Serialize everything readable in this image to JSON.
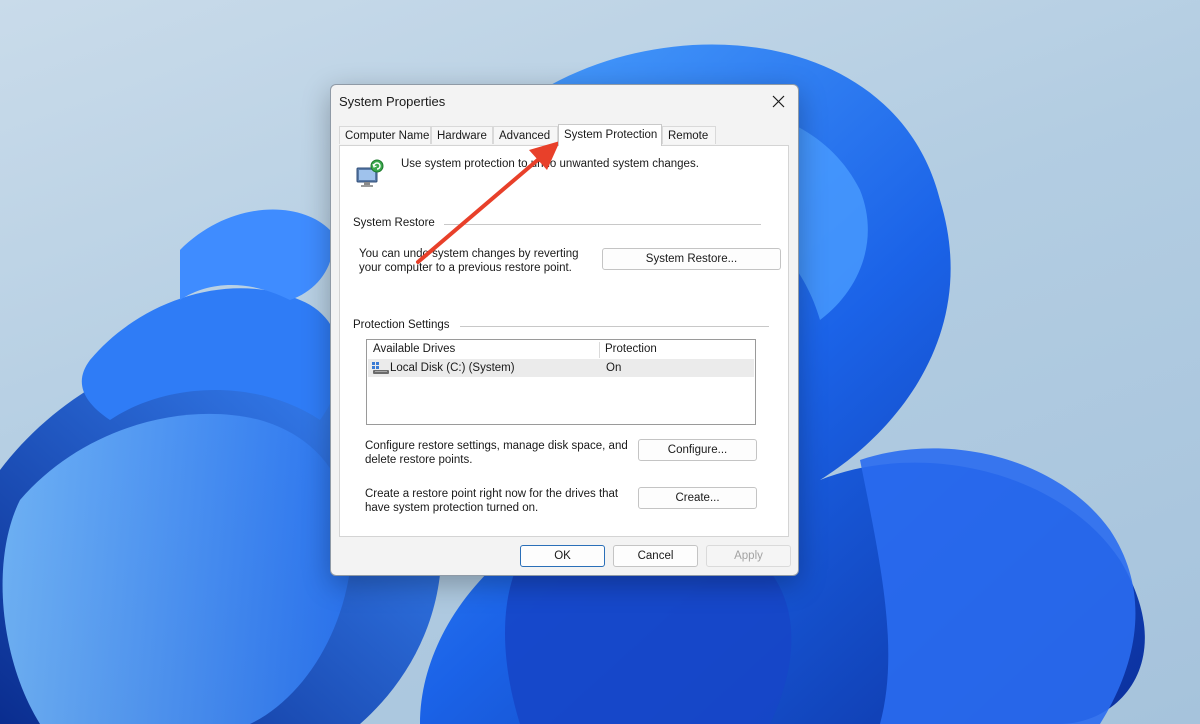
{
  "window": {
    "title": "System Properties"
  },
  "tabs": [
    {
      "label": "Computer Name"
    },
    {
      "label": "Hardware"
    },
    {
      "label": "Advanced"
    },
    {
      "label": "System Protection",
      "active": true
    },
    {
      "label": "Remote"
    }
  ],
  "intro_text": "Use system protection to undo unwanted system changes.",
  "system_restore": {
    "group_label": "System Restore",
    "description_line1": "You can undo system changes by reverting",
    "description_line2": "your computer to a previous restore point.",
    "button_label": "System Restore..."
  },
  "protection_settings": {
    "group_label": "Protection Settings",
    "columns": [
      "Available Drives",
      "Protection"
    ],
    "drives": [
      {
        "name": "Local Disk (C:) (System)",
        "protection": "On"
      }
    ]
  },
  "configure": {
    "description_line1": "Configure restore settings, manage disk space, and",
    "description_line2": "delete restore points.",
    "button_label": "Configure..."
  },
  "create": {
    "description_line1": "Create a restore point right now for the drives that",
    "description_line2": "have system protection turned on.",
    "button_label": "Create..."
  },
  "footer": {
    "ok_label": "OK",
    "cancel_label": "Cancel",
    "apply_label": "Apply"
  },
  "icons": {
    "close": "close-icon",
    "system-protection": "system-protection-icon",
    "disk": "disk-icon"
  },
  "colors": {
    "annotation_arrow": "#e8402a",
    "wallpaper_blue": "#1f5fe0",
    "primary_button_border": "#2a6fb8"
  }
}
